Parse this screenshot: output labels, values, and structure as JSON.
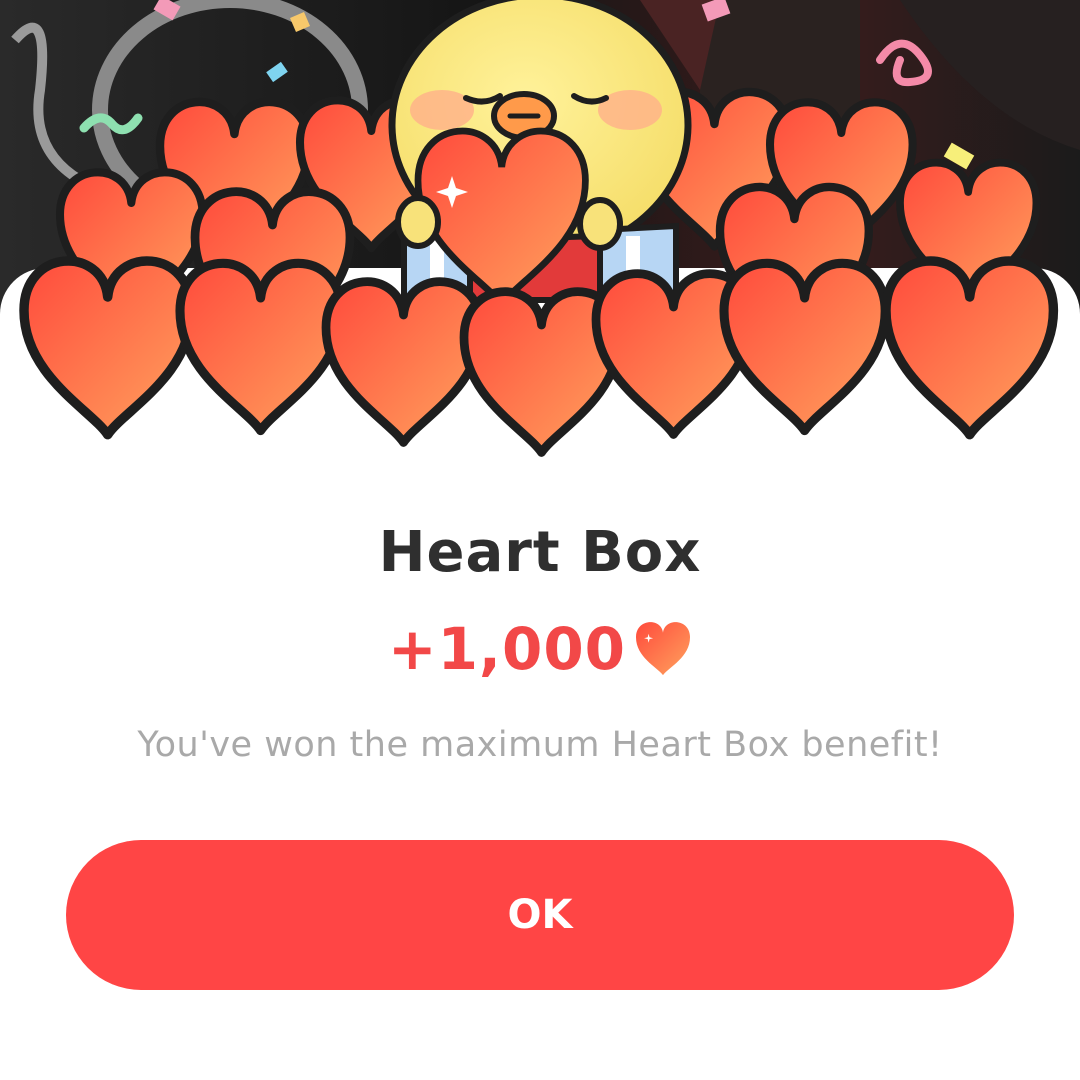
{
  "dialog": {
    "title": "Heart Box",
    "reward_amount": "+1,000",
    "reward_icon": "heart-icon",
    "message": "You've won the maximum Heart Box benefit!",
    "ok_label": "OK"
  },
  "colors": {
    "accent": "#ff4545",
    "reward_text": "#f24848",
    "title_text": "#2f2f2f",
    "message_text": "#a9a9a9",
    "heart_fill_top": "#ff4d3d",
    "heart_fill_bottom": "#ffa35c",
    "chick": "#fbe77a"
  }
}
